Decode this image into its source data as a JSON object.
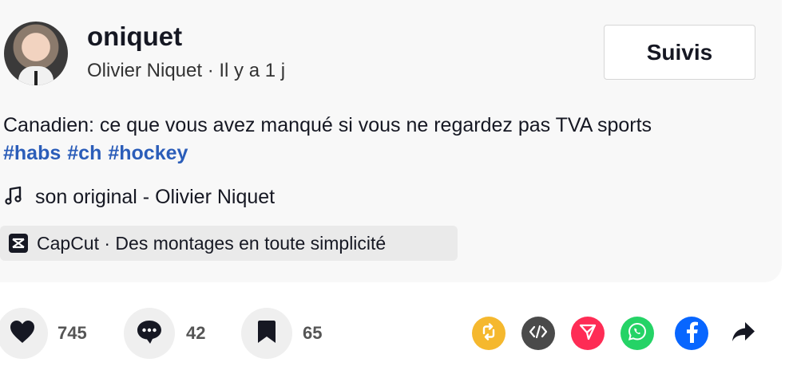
{
  "author": {
    "username": "oniquet",
    "display_name": "Olivier Niquet",
    "time_ago": "Il y a 1 j",
    "separator": " · "
  },
  "follow_button": {
    "label": "Suivis"
  },
  "description": {
    "text": "Canadien: ce que vous avez manqué si vous ne regardez pas TVA sports",
    "hashtags": [
      "#habs",
      "#ch",
      "#hockey"
    ]
  },
  "music": {
    "icon": "music-note-icon",
    "label": "son original - Olivier Niquet"
  },
  "capcut": {
    "icon": "capcut-icon",
    "label": "CapCut · Des montages en toute simplicité"
  },
  "stats": {
    "likes": "745",
    "comments": "42",
    "saves": "65"
  },
  "share": {
    "items": [
      {
        "name": "repost-icon",
        "color": "#f5b82e"
      },
      {
        "name": "embed-icon",
        "color": "#4a4a4a"
      },
      {
        "name": "send-icon",
        "color": "#fe2c55"
      },
      {
        "name": "whatsapp-icon",
        "color": "#25d366"
      },
      {
        "name": "facebook-icon",
        "color": "#0866ff"
      },
      {
        "name": "share-arrow-icon",
        "color": "#161823"
      }
    ]
  }
}
